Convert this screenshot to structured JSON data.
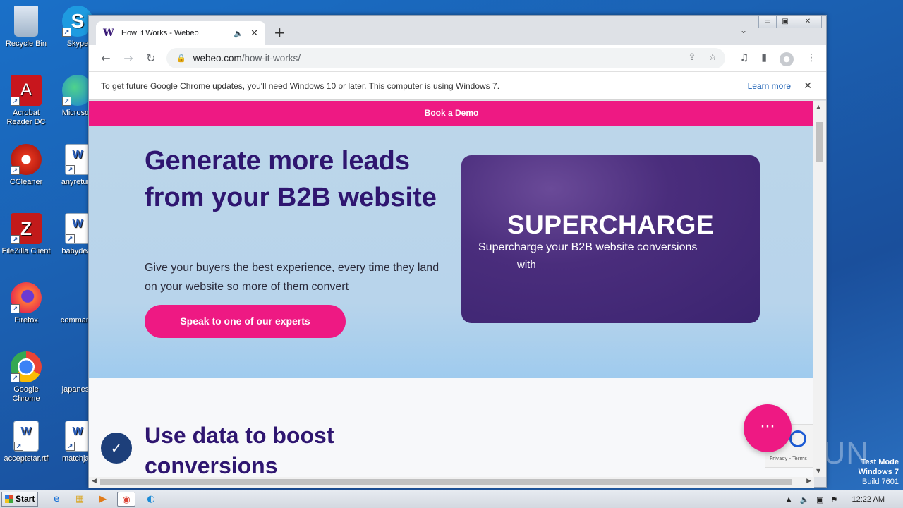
{
  "desktop": {
    "icons": [
      {
        "label": "Recycle Bin",
        "icon": "recycle-bin-icon"
      },
      {
        "label": "Skype",
        "icon": "skype-icon"
      },
      {
        "label": "Acrobat Reader DC",
        "icon": "acrobat-icon"
      },
      {
        "label": "Microsoft",
        "icon": "edge-icon"
      },
      {
        "label": "CCleaner",
        "icon": "ccleaner-icon"
      },
      {
        "label": "anyreturn",
        "icon": "word-doc-icon"
      },
      {
        "label": "FileZilla Client",
        "icon": "filezilla-icon"
      },
      {
        "label": "babydeat",
        "icon": "word-doc-icon"
      },
      {
        "label": "Firefox",
        "icon": "firefox-icon"
      },
      {
        "label": "command",
        "icon": "blank-file-icon"
      },
      {
        "label": "Google Chrome",
        "icon": "chrome-icon"
      },
      {
        "label": "japanese",
        "icon": "blank-file-icon"
      },
      {
        "label": "acceptstar.rtf",
        "icon": "word-doc-icon"
      },
      {
        "label": "matchjac",
        "icon": "word-doc-icon"
      }
    ],
    "watermark": "ANY RUN",
    "test_mode": {
      "line1": "Test Mode",
      "line2": "Windows 7",
      "line3": "Build 7601"
    }
  },
  "browser": {
    "tab": {
      "favicon": "W",
      "title": "How It Works - Webeo",
      "speaker": "🔈",
      "close": "✕"
    },
    "new_tab": "+",
    "tab_menu": "⌄",
    "window_controls": {
      "minimize": "▭",
      "maximize": "▣",
      "close": "✕"
    },
    "url": {
      "host": "webeo.com",
      "path": "/how-it-works/"
    },
    "infobar": {
      "message": "To get future Google Chrome updates, you'll need Windows 10 or later. This computer is using Windows 7.",
      "link": "Learn more",
      "close": "✕"
    }
  },
  "page": {
    "demo_bar": "Book a Demo",
    "hero": {
      "heading": "Generate more leads from your B2B website",
      "subheading": "Give your buyers the best experience, every time they land on your website so more of them convert",
      "cta": "Speak to one of our experts"
    },
    "video": {
      "title": "SUPERCHARGE",
      "line1": "Supercharge your B2B website conversions",
      "line2": "with"
    },
    "section2": {
      "heading": "Use data to boost conversions"
    },
    "chat_icon": "···",
    "recaptcha": "Privacy - Terms"
  },
  "taskbar": {
    "start": "Start",
    "clock": "12:22 AM"
  },
  "colors": {
    "brand_pink": "#ee1983",
    "brand_purple": "#2f1670",
    "hero_bg": "#bcd6ea"
  }
}
